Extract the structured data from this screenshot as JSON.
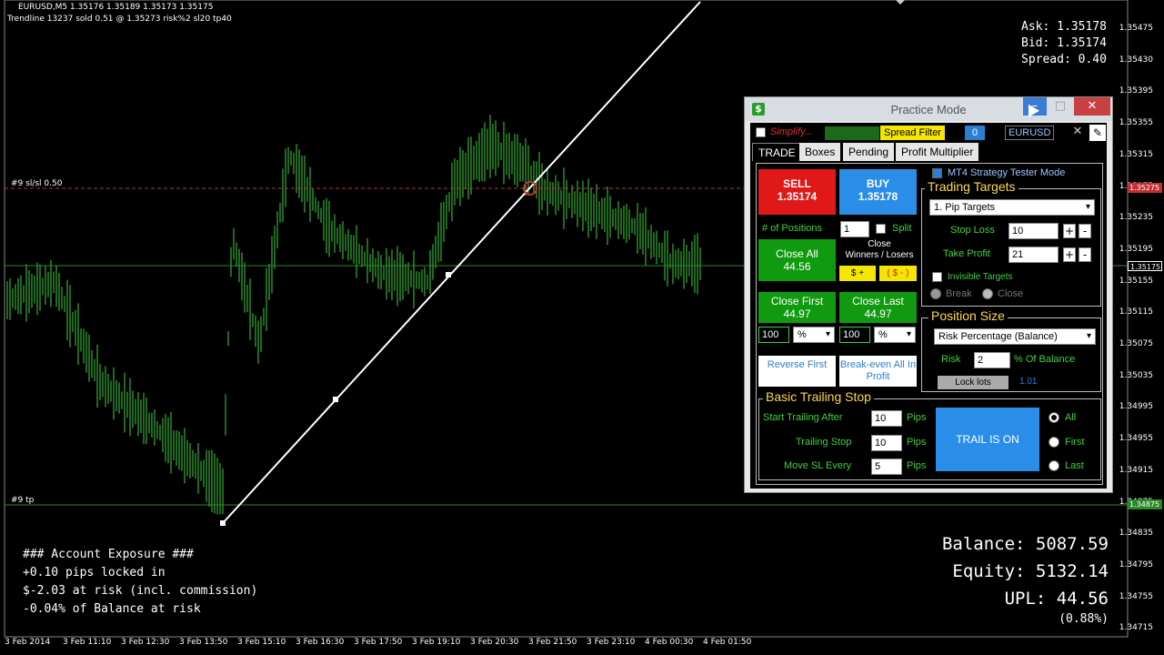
{
  "chart": {
    "symbol_line": "EURUSD,M5  1.35176 1.35189 1.35173 1.35175",
    "trendline_line": "Trendline 13237 sold 0.51 @ 1.35273  risk%2 sl20 tp40",
    "sl_label": "#9 sl/sl 0.50",
    "tp_label": "#9 tp",
    "ask": "Ask: 1.35178",
    "bid": "Bid: 1.35174",
    "spread": "Spread: 0.40",
    "exposure": {
      "title": "### Account Exposure ###",
      "line1": "+0.10 pips locked in",
      "line2": "$-2.03 at risk (incl. commission)",
      "line3": "-0.04% of Balance at risk"
    },
    "balance": "Balance: 5087.59",
    "equity": "Equity: 5132.14",
    "upl": "UPL: 44.56",
    "upl_pct": "(0.88%)",
    "y_ticks": [
      "1.35475",
      "1.35430",
      "1.35395",
      "1.35355",
      "1.35315",
      "1.35275",
      "1.35235",
      "1.35195",
      "1.35155",
      "1.35115",
      "1.35075",
      "1.35035",
      "1.34995",
      "1.34955",
      "1.34915",
      "1.34875",
      "1.34835",
      "1.34795",
      "1.34755",
      "1.34715"
    ],
    "y_tags": {
      "sl": "1.35275",
      "price": "1.35175",
      "tp": "1.34875"
    },
    "x_ticks": [
      "3 Feb 2014",
      "3 Feb 11:10",
      "3 Feb 12:30",
      "3 Feb 13:50",
      "3 Feb 15:10",
      "3 Feb 16:30",
      "3 Feb 17:50",
      "3 Feb 19:10",
      "3 Feb 20:30",
      "3 Feb 21:50",
      "3 Feb 23:10",
      "4 Feb 00:30",
      "4 Feb 01:50"
    ],
    "colors": {
      "candles": "#3fd13f",
      "sl_line": "#c43030",
      "tp_line": "#2a8a2a",
      "trendline": "#ffffff"
    }
  },
  "panel": {
    "title": "Practice Mode",
    "simplify": "Simplify...",
    "spread_filter": "Spread Filter",
    "spread_filter_value": "0",
    "symbol": "EURUSD",
    "tabs": [
      "TRADE",
      "Boxes",
      "Pending",
      "Profit Multiplier"
    ],
    "sell_label": "SELL",
    "sell_price": "1.35174",
    "buy_label": "BUY",
    "buy_price": "1.35178",
    "positions_label": "# of Positions",
    "positions_value": "1",
    "split_label": "Split",
    "close_all_label": "Close All",
    "close_all_value": "44.56",
    "close_wl_label": "Close\nWinners / Losers",
    "winners_btn": "$ +",
    "losers_btn": "( $ - )",
    "close_first_label": "Close First",
    "close_first_value": "44.97",
    "close_last_label": "Close Last",
    "close_last_value": "44.97",
    "first_pct_value": "100",
    "last_pct_value": "100",
    "pct_option": "%",
    "reverse_first": "Reverse First",
    "breakeven": "Break-even All In Profit",
    "tester_mode": "MT4 Strategy Tester Mode",
    "targets_title": "Trading Targets",
    "targets_select": "1. Pip Targets",
    "stop_loss_label": "Stop Loss",
    "stop_loss_value": "10",
    "take_profit_label": "Take Profit",
    "take_profit_value": "21",
    "invisible_targets": "Invisible Targets",
    "break_label": "Break",
    "close_label": "Close",
    "position_size_title": "Position Size",
    "position_size_select": "Risk Percentage (Balance)",
    "risk_label": "Risk",
    "risk_value": "2",
    "of_balance": "% Of Balance",
    "lock_lots": "Lock lots",
    "lots_value": "1.01",
    "trailing_title": "Basic Trailing Stop",
    "start_trailing_label": "Start Trailing After",
    "start_trailing_value": "10",
    "trailing_stop_label": "Trailing Stop",
    "trailing_stop_value": "10",
    "move_sl_label": "Move SL Every",
    "move_sl_value": "5",
    "pips": "Pips",
    "trail_btn": "TRAIL IS ON",
    "radio_all": "All",
    "radio_first": "First",
    "radio_last": "Last"
  }
}
